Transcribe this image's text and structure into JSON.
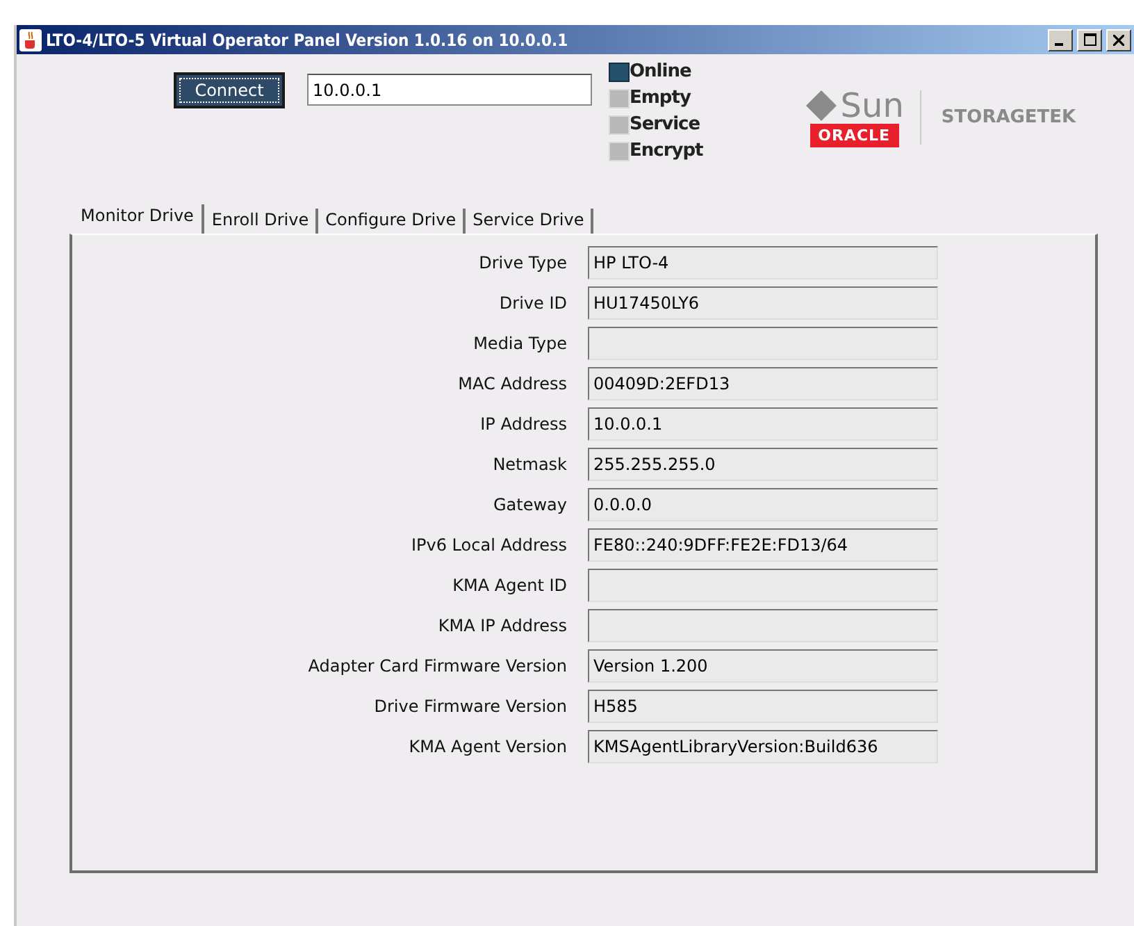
{
  "window": {
    "title": "LTO-4/LTO-5 Virtual Operator Panel Version 1.0.16 on 10.0.0.1"
  },
  "connection": {
    "button": "Connect",
    "address": "10.0.0.1"
  },
  "indicators": [
    {
      "label": "Online",
      "on": true
    },
    {
      "label": "Empty",
      "on": false
    },
    {
      "label": "Service",
      "on": false
    },
    {
      "label": "Encrypt",
      "on": false
    }
  ],
  "logo": {
    "sun": "Sun",
    "oracle": "ORACLE",
    "brand": "STORAGETEK"
  },
  "tabs": [
    {
      "label": "Monitor Drive",
      "selected": true
    },
    {
      "label": "Enroll Drive",
      "selected": false
    },
    {
      "label": "Configure Drive",
      "selected": false
    },
    {
      "label": "Service Drive",
      "selected": false
    }
  ],
  "fields": [
    {
      "label": "Drive Type",
      "value": "HP LTO-4"
    },
    {
      "label": "Drive ID",
      "value": "HU17450LY6"
    },
    {
      "label": "Media Type"
    },
    {
      "label": "MAC Address",
      "value": "00409D:2EFD13"
    },
    {
      "label": "IP Address",
      "value": "10.0.0.1"
    },
    {
      "label": "Netmask",
      "value": "255.255.255.0"
    },
    {
      "label": "Gateway",
      "value": "0.0.0.0"
    },
    {
      "label": "IPv6 Local Address",
      "value": "FE80::240:9DFF:FE2E:FD13/64"
    },
    {
      "label": "KMA Agent ID"
    },
    {
      "label": "KMA IP Address"
    },
    {
      "label": "Adapter Card Firmware Version",
      "value": "Version 1.200"
    },
    {
      "label": "Drive Firmware Version",
      "value": "H585"
    },
    {
      "label": "KMA Agent Version",
      "value": "KMSAgentLibraryVersion:Build636"
    }
  ]
}
